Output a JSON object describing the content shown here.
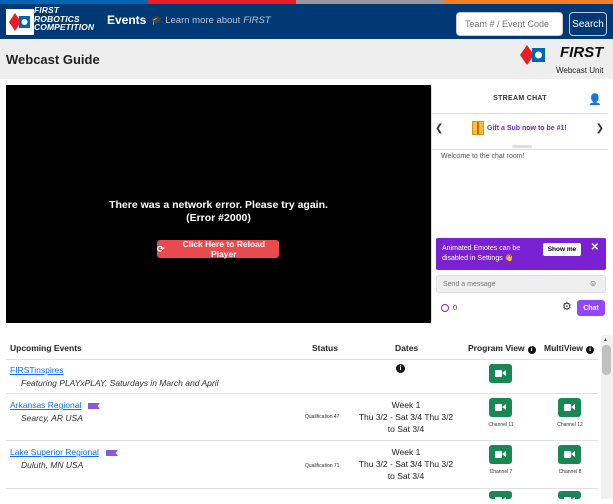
{
  "colors": {
    "nav_bg": "#003974",
    "stripe": [
      "#0066b3",
      "#ed1c24",
      "#9a989a",
      "#f57e25"
    ],
    "green": "#198754",
    "twitch": "#9147ff"
  },
  "nav": {
    "brand_lines": [
      "FIRST",
      "ROBOTICS",
      "COMPETITION"
    ],
    "events_label": "Events",
    "learn_label": "Learn more about",
    "learn_brand": "FIRST",
    "search_placeholder": "Team # / Event Code",
    "search_button": "Search"
  },
  "header": {
    "title": "Webcast Guide",
    "logo_text": "FIRST",
    "logo_sub": "Webcast Unit"
  },
  "player": {
    "error_line1": "There was a network error. Please try again.",
    "error_line2": "(Error #2000)",
    "reload_label": "Click Here to Reload Player"
  },
  "chat": {
    "title": "STREAM CHAT",
    "gift_label": "Gift a Sub now to be #1!",
    "welcome": "Welcome to the chat room!",
    "emote_notice": "Animated Emotes can be disabled in Settings",
    "show_me": "Show me",
    "close": "✕",
    "message_placeholder": "Send a message",
    "points": "0",
    "chat_button": "Chat"
  },
  "table": {
    "headers": {
      "events": "Upcoming Events",
      "status": "Status",
      "dates": "Dates",
      "program": "Program View",
      "multi": "MultiView"
    },
    "rows": [
      {
        "name": "FIRSTinspires",
        "sub": "Featuring PLAYxPLAY, Saturdays in March and April",
        "status": "",
        "dates": [
          "",
          ""
        ],
        "channel_program": "",
        "channel_multi": ""
      },
      {
        "name": "Arkansas Regional",
        "sub": "Searcy, AR USA",
        "status": "Qualification 47",
        "dates": [
          "Week 1",
          "Thu 3/2 - Sat 3/4 Thu 3/2",
          "to Sat 3/4"
        ],
        "channel_program": "Channel 11",
        "channel_multi": "Channel 12"
      },
      {
        "name": "Lake Superior Regional",
        "sub": "Duluth, MN USA",
        "status": "Qualification 71",
        "dates": [
          "Week 1",
          "Thu 3/2 - Sat 3/4 Thu 3/2",
          "to Sat 3/4"
        ],
        "channel_program": "Channel 7",
        "channel_multi": "Channel 8"
      }
    ]
  }
}
